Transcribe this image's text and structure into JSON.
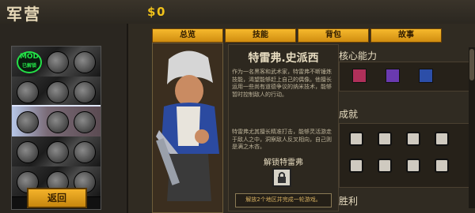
{
  "header": {
    "title": "军营",
    "currency_symbol": "$",
    "money": "0"
  },
  "roster": {
    "mod_badge": "MOD",
    "mod_sub": "已解锁",
    "back_label": "返回"
  },
  "tabs": [
    {
      "label": "总览"
    },
    {
      "label": "技能"
    },
    {
      "label": "背包"
    },
    {
      "label": "故事"
    }
  ],
  "character": {
    "name": "特雷弗.史派西",
    "desc1": "作为一名黑客和武术家，特雷弗不断锤炼技能，渴望能够赶上自己的偶像。他擅长运用一些尚有道德争议的纳米技术，能够暂时控制敌人的行动。",
    "desc2": "特雷弗尤其擅长精准打击，能够灵活游走于敌人之中，洞察敌人反叉相向，自己则是满之木吝。",
    "unlock_label": "解锁特雷弗",
    "unlock_note": "解放2个地区并完成一轮游戏。"
  },
  "sections": {
    "core": "核心能力",
    "achievements": "成就",
    "victory": "胜利"
  },
  "colors": {
    "accent": "#f1c21a",
    "tab_bg": "#f6b92d",
    "mod_green": "#24e048"
  },
  "icons": {
    "core": [
      "ability-1-icon",
      "ability-2-icon",
      "ability-3-icon"
    ],
    "achievements": [
      "achievement-icon"
    ]
  }
}
